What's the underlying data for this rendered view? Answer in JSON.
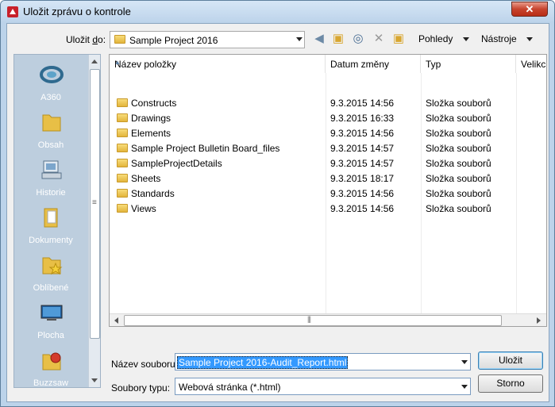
{
  "window": {
    "title": "Uložit zprávu o kontrole",
    "close_glyph": "✕"
  },
  "toolbar": {
    "save_in_label": "Uložit do:",
    "save_in_underline": "d",
    "path_value": "Sample Project 2016",
    "views_label": "Pohledy",
    "tools_label": "Nástroje",
    "icons": [
      "back-arrow-icon",
      "up-folder-icon",
      "search-web-icon",
      "delete-icon",
      "new-folder-icon"
    ]
  },
  "places": [
    {
      "id": "a360",
      "label": "A360",
      "icon": "a360-icon"
    },
    {
      "id": "obsah",
      "label": "Obsah",
      "icon": "folder-icon"
    },
    {
      "id": "historie",
      "label": "Historie",
      "icon": "history-icon"
    },
    {
      "id": "dokumenty",
      "label": "Dokumenty",
      "icon": "documents-icon"
    },
    {
      "id": "oblibene",
      "label": "Oblíbené",
      "icon": "favorites-icon"
    },
    {
      "id": "plocha",
      "label": "Plocha",
      "icon": "desktop-icon"
    },
    {
      "id": "buzzsaw",
      "label": "Buzzsaw",
      "icon": "buzzsaw-icon"
    }
  ],
  "filelist": {
    "columns": [
      "Název položky",
      "Datum změny",
      "Typ",
      "Velikc"
    ],
    "rows": [
      {
        "name": "Constructs",
        "date": "9.3.2015 14:56",
        "type": "Složka souborů"
      },
      {
        "name": "Drawings",
        "date": "9.3.2015 16:33",
        "type": "Složka souborů"
      },
      {
        "name": "Elements",
        "date": "9.3.2015 14:56",
        "type": "Složka souborů"
      },
      {
        "name": "Sample Project Bulletin Board_files",
        "date": "9.3.2015 14:57",
        "type": "Složka souborů"
      },
      {
        "name": "SampleProjectDetails",
        "date": "9.3.2015 14:57",
        "type": "Složka souborů"
      },
      {
        "name": "Sheets",
        "date": "9.3.2015 18:17",
        "type": "Složka souborů"
      },
      {
        "name": "Standards",
        "date": "9.3.2015 14:56",
        "type": "Složka souborů"
      },
      {
        "name": "Views",
        "date": "9.3.2015 14:56",
        "type": "Složka souborů"
      }
    ]
  },
  "form": {
    "filename_label": "Název souboru:",
    "filename_value": "Sample Project 2016-Audit_Report.html",
    "filetype_label": "Soubory typu:",
    "filetype_value": "Webová stránka (*.html)",
    "save_button": "Uložit",
    "cancel_button": "Storno"
  },
  "colors": {
    "title_bar": "#bcd3ea",
    "places_bg": "#bdcede",
    "selection": "#3399ff",
    "close_button": "#c7442e"
  }
}
